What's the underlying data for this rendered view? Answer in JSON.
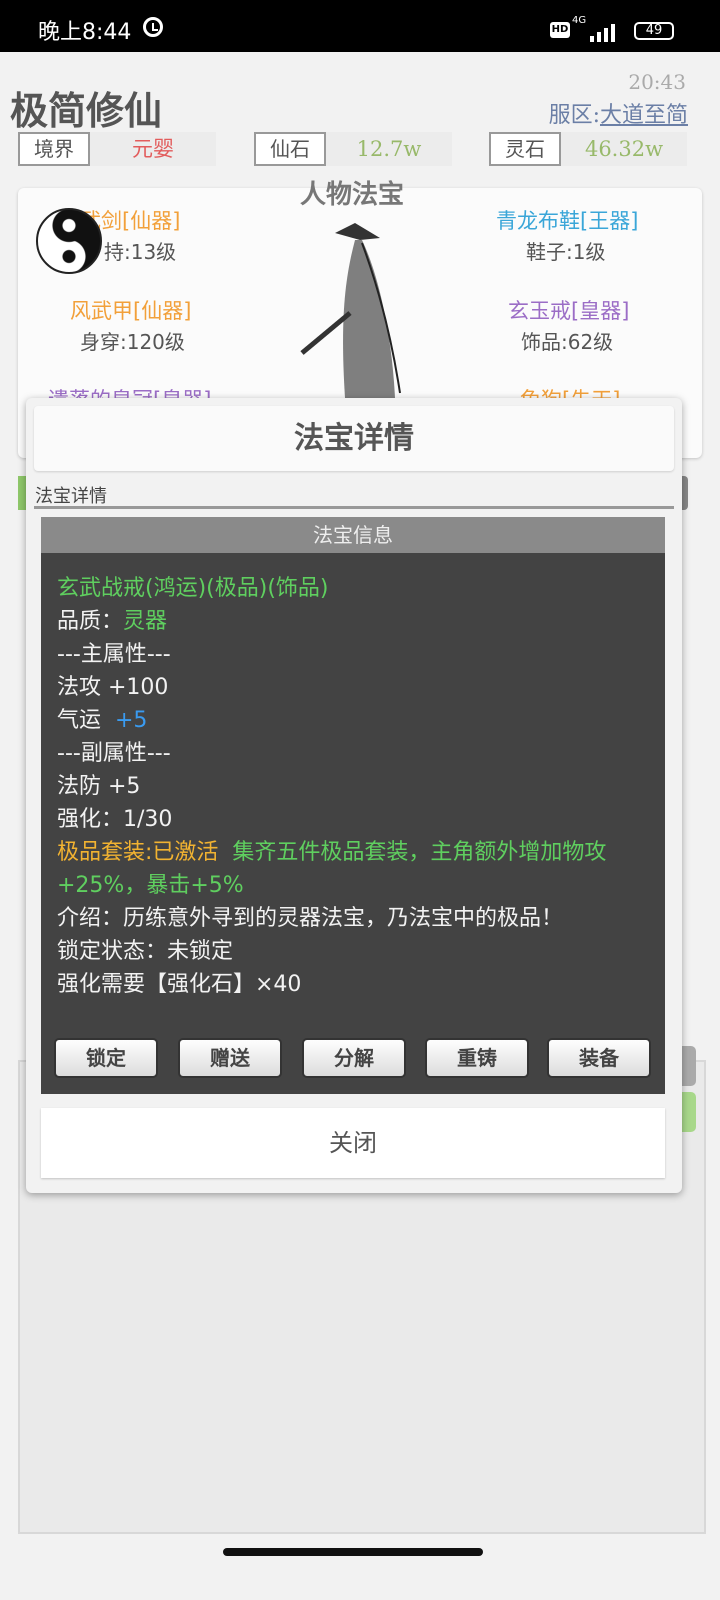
{
  "status_bar": {
    "time": "晚上8:44",
    "network": "4G",
    "battery": "49"
  },
  "background": {
    "game_title": "极简修仙",
    "clock": "20:43",
    "server_label": "服区:",
    "server_name": "大道至简",
    "resources": [
      {
        "label": "境界",
        "value": "元婴",
        "color": "#e25c5c"
      },
      {
        "label": "仙石",
        "value": "12.7w",
        "color": "#98b96a"
      },
      {
        "label": "灵石",
        "value": "46.32w",
        "color": "#98b96a"
      }
    ],
    "equipment_panel_title": "人物法宝",
    "equipment_left": [
      {
        "name": "武剑[仙器]",
        "sub": "持:13级",
        "color": "#f2a03a"
      },
      {
        "name": "风武甲[仙器]",
        "sub": "身穿:120级",
        "color": "#f2a03a"
      },
      {
        "name": "遗落的皇冠[皇器]",
        "color": "#9b6dc6"
      }
    ],
    "equipment_right": [
      {
        "name": "青龙布鞋[王器]",
        "sub": "鞋子:1级",
        "color": "#3aa6d8"
      },
      {
        "name": "玄玉戒[皇器]",
        "sub": "饰品:62级",
        "color": "#9b6dc6"
      },
      {
        "name": "兔狗[先天]",
        "color": "#f2a03a"
      }
    ]
  },
  "dialog": {
    "title": "法宝详情",
    "subtitle": "法宝详情",
    "info_title": "法宝信息",
    "item_name": "玄武战戒(鸿运)(极品)(饰品)",
    "quality_label": "品质：",
    "quality_value": "灵器",
    "main_attr_header": "---主属性---",
    "main_attr_1": "法攻  +100",
    "main_attr_2_label": "气运  ",
    "main_attr_2_value": "+5",
    "sub_attr_header": "---副属性---",
    "sub_attr_1": "法防  +5",
    "enhance": "强化：1/30",
    "set_status": "极品套装:已激活",
    "set_desc_1": "集齐五件极品套装，主角额外增加物攻",
    "set_desc_2": "+25%，暴击+5%",
    "intro": "介绍：历练意外寻到的灵器法宝，乃法宝中的极品！",
    "lock_status": "锁定状态：未锁定",
    "enhance_need": "强化需要【强化石】×40",
    "buttons": [
      "锁定",
      "赠送",
      "分解",
      "重铸",
      "装备"
    ],
    "close_label": "关闭"
  }
}
